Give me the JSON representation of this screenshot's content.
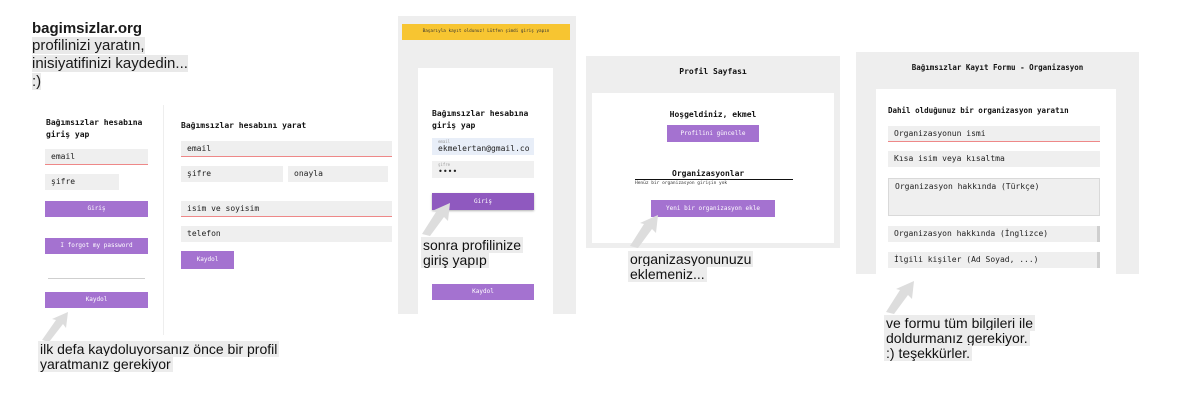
{
  "intro": {
    "brand": "bagimsizlar.org",
    "line1": "profilinizi yaratın,",
    "line2": "inisiyatifinizi kaydedin...",
    "line3": ":)"
  },
  "screen1": {
    "login_title": "Bağımsızlar hesabına\ngiriş yap",
    "email_placeholder": "email",
    "password_placeholder": "şifre",
    "login_button": "Giriş",
    "forgot_button": "I forgot my password",
    "register_button": "Kaydol",
    "create_title": "Bağımsızlar hesabını yarat",
    "create_email": "email",
    "create_password": "şifre",
    "create_confirm": "onayla",
    "create_name": "isim ve soyisim",
    "create_phone": "telefon",
    "create_register": "Kaydol"
  },
  "caption1": {
    "line1": "ilk defa kaydoluyorsanız önce bir profil",
    "line2": "yaratmanız gerekiyor"
  },
  "screen2": {
    "banner": "Başarıyla kayıt oldunuz! Lütfen şimdi giriş yapın",
    "login_title": "Bağımsızlar hesabına\ngiriş yap",
    "email_label": "email",
    "email_value": "ekmelertan@gmail.co",
    "password_label": "şifre",
    "password_value": "••••",
    "login_button": "Giriş",
    "register_button": "Kaydol"
  },
  "caption2": {
    "line1": "sonra profilinize",
    "line2": "giriş yapıp"
  },
  "screen3": {
    "header": "Profil Sayfası",
    "welcome": "Hoşgeldiniz, ekmel",
    "update_button": "Profilini güncelle",
    "orgs_title": "Organizasyonlar",
    "orgs_empty": "Henüz bir organizasyon girişin yok",
    "add_org_button": "Yeni bir organizasyon ekle"
  },
  "caption3": {
    "line1": "organizasyonunuzu",
    "line2": "eklemeniz..."
  },
  "screen4": {
    "header": "Bağımsızlar Kayıt Formu - Organizasyon",
    "form_title": "Dahil olduğunuz bir organizasyon yaratın",
    "org_name": "Organizasyonun ismi",
    "short_name": "Kısa isim veya kısaltma",
    "about_tr": "Organizasyon hakkında (Türkçe)",
    "about_en": "Organizasyon hakkında (İnglizce)",
    "contacts": "İlgili kişiler (Ad Soyad, ...)"
  },
  "caption4": {
    "line1": "ve formu tüm bilgileri ile",
    "line2": "doldurmanız gerekiyor.",
    "line3": ":) teşekkürler."
  }
}
